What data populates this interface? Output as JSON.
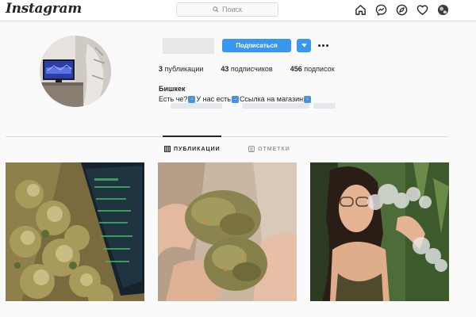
{
  "nav": {
    "logo": "Instagram",
    "search_placeholder": "Поиск",
    "icons": [
      "home-icon",
      "messenger-icon",
      "explore-compass-icon",
      "heart-icon",
      "profile-avatar-icon"
    ]
  },
  "profile": {
    "follow_label": "Подписаться",
    "stats": {
      "posts_count": "3",
      "posts_label": "публикации",
      "followers_count": "43",
      "followers_label": "подписчиков",
      "following_count": "456",
      "following_label": "подписок"
    },
    "full_name": "Бишкек",
    "bio": {
      "part1": "Есть че?",
      "part2": "У нас есть",
      "part3": "Ссылка на магазин"
    }
  },
  "tabs": {
    "posts_label": "ПУБЛИКАЦИИ",
    "tagged_label": "ОТМЕТКИ"
  },
  "colors": {
    "accent": "#3897f0",
    "text": "#262626",
    "muted": "#8e8e8e",
    "border": "#dbdbdb",
    "background": "#fafafa"
  }
}
